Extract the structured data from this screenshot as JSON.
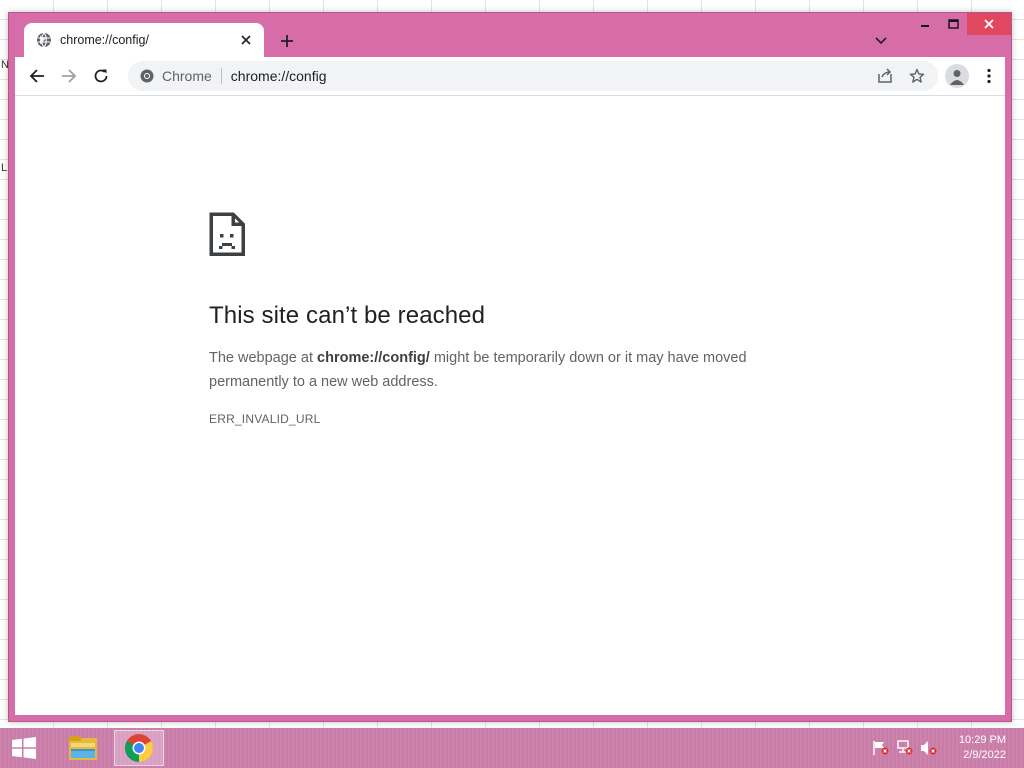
{
  "desktop": {
    "edge_mark_top": "N",
    "edge_mark_mid": "L"
  },
  "browser": {
    "tab": {
      "title": "chrome://config/",
      "icon": "globe-icon"
    },
    "window_controls": {
      "minimize_icon": "minimize-icon",
      "maximize_icon": "maximize-icon",
      "close_icon": "close-icon"
    },
    "toolbar": {
      "back_icon": "back-arrow-icon",
      "forward_icon": "forward-arrow-icon",
      "reload_icon": "reload-icon",
      "omnibox": {
        "chip_label": "Chrome",
        "url": "chrome://config"
      },
      "share_icon": "share-icon",
      "bookmark_icon": "star-icon",
      "profile_icon": "profile-icon",
      "menu_icon": "kebab-menu-icon"
    },
    "frame_color": "#d66ca8"
  },
  "error_page": {
    "icon": "sad-page-icon",
    "heading": "This site can’t be reached",
    "body_prefix": "The webpage at ",
    "body_url": "chrome://config/",
    "body_suffix": " might be temporarily down or it may have moved permanently to a new web address.",
    "error_code": "ERR_INVALID_URL"
  },
  "taskbar": {
    "start_icon": "windows-logo-icon",
    "apps": [
      {
        "name": "file-explorer",
        "icon": "folder-icon"
      },
      {
        "name": "chrome",
        "icon": "chrome-icon"
      }
    ],
    "tray": [
      "flag-icon",
      "network-icon",
      "volume-muted-icon"
    ],
    "clock": {
      "time": "10:29 PM",
      "date": "2/9/2022"
    },
    "color": "#c97ca8"
  }
}
